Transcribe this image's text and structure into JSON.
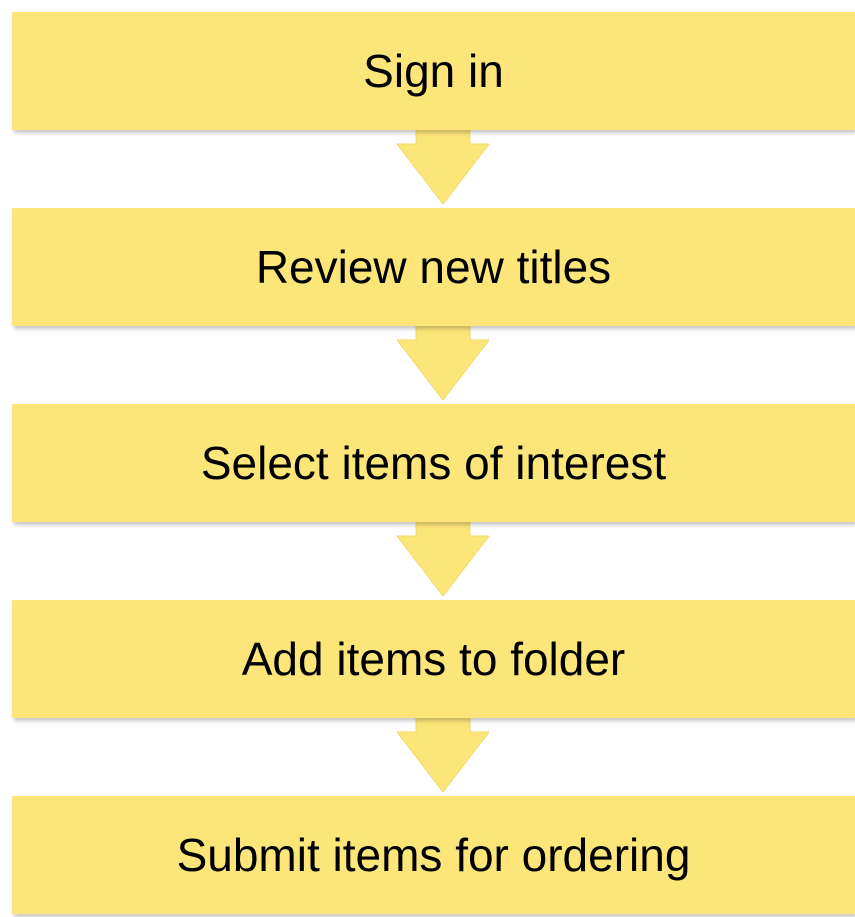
{
  "flowchart": {
    "fill_color": "#fce67a",
    "text_color": "#000000",
    "steps": [
      {
        "label": "Sign in"
      },
      {
        "label": "Review new titles"
      },
      {
        "label": "Select items of interest"
      },
      {
        "label": "Add items to folder"
      },
      {
        "label": "Submit items for ordering"
      }
    ]
  }
}
